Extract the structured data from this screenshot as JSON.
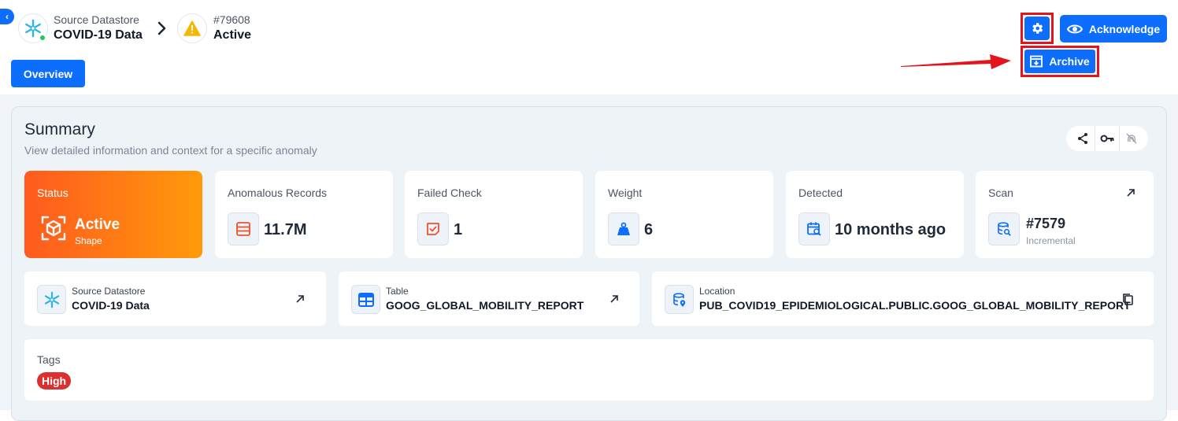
{
  "breadcrumb": {
    "datastore": {
      "label": "Source Datastore",
      "name": "COVID-19 Data",
      "icon": "snowflake-icon",
      "status_color": "#22c55e"
    },
    "anomaly": {
      "id": "#79608",
      "status": "Active",
      "icon": "warning-icon"
    }
  },
  "header_actions": {
    "settings_icon": "gear-icon",
    "acknowledge_label": "Acknowledge",
    "archive_label": "Archive"
  },
  "tabs": [
    {
      "label": "Overview",
      "active": true
    }
  ],
  "summary": {
    "title": "Summary",
    "subtitle": "View detailed information and context for a specific anomaly",
    "actions": [
      "share-icon",
      "key-icon",
      "fingerprint-off-icon"
    ]
  },
  "cards": {
    "status": {
      "label": "Status",
      "value": "Active",
      "sub": "Shape"
    },
    "anomalous_records": {
      "label": "Anomalous Records",
      "value": "11.7M"
    },
    "failed_check": {
      "label": "Failed Check",
      "value": "1"
    },
    "weight": {
      "label": "Weight",
      "value": "6"
    },
    "detected": {
      "label": "Detected",
      "value": "10 months ago"
    },
    "scan": {
      "label": "Scan",
      "value": "#7579",
      "sub": "Incremental"
    }
  },
  "info": {
    "datastore": {
      "label": "Source Datastore",
      "value": "COVID-19 Data"
    },
    "table": {
      "label": "Table",
      "value": "GOOG_GLOBAL_MOBILITY_REPORT"
    },
    "location": {
      "label": "Location",
      "value": "PUB_COVID19_EPIDEMIOLOGICAL.PUBLIC.GOOG_GLOBAL_MOBILITY_REPORT"
    }
  },
  "tags": {
    "label": "Tags",
    "items": [
      "High"
    ]
  },
  "colors": {
    "primary": "#0d6efd",
    "highlight": "#e3141b",
    "status_gradient_start": "#ff5a1f",
    "status_gradient_end": "#ff9a0a",
    "tag_high": "#dc2f2f"
  }
}
